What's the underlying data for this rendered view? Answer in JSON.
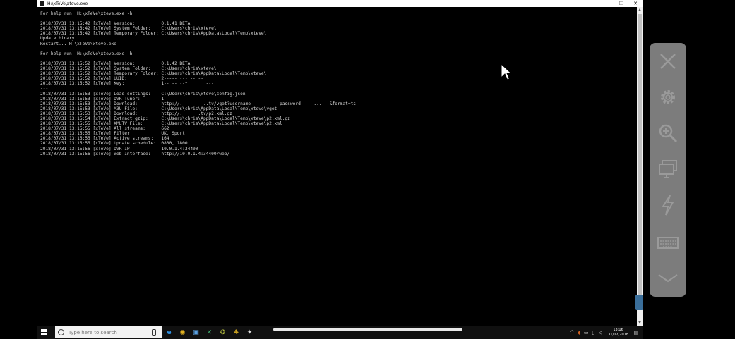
{
  "window": {
    "title": "H:\\xTeVe\\xteve.exe",
    "minimize": "—",
    "maximize": "❐",
    "close": "✕"
  },
  "console": {
    "lines": [
      "For help run: H:\\xTeVe\\xteve.exe -h",
      "",
      "2018/07/31 13:15:42 [xTeVe] Version:          0.1.41 BETA",
      "2018/07/31 13:15:42 [xTeVe] System Folder:    C:\\Users\\chris\\xteve\\",
      "2018/07/31 13:15:42 [xTeVe] Temporary Folder: C:\\Users\\chris\\AppData\\Local\\Temp\\xteve\\",
      "Update binary...",
      "Restart... H:\\xTeVe\\xteve.exe",
      "",
      "For help run: H:\\xTeVe\\xteve.exe -h",
      "",
      "2018/07/31 13:15:52 [xTeVe] Version:          0.1.42 BETA",
      "2018/07/31 13:15:52 [xTeVe] System Folder:    C:\\Users\\chris\\xteve\\",
      "2018/07/31 13:15:52 [xTeVe] Temporary Folder: C:\\Users\\chris\\AppData\\Local\\Temp\\xteve\\",
      "2018/07/31 13:15:52 [xTeVe] UUID:             2----- --- -- --",
      "2018/07/31 13:15:52 [xTeVe] Key:              1-- -- --*       ---",
      "---",
      "2018/07/31 13:15:53 [xTeVe] Load settings:    C:\\Users\\chris\\xteve\\config.json",
      "2018/07/31 13:15:53 [xTeVe] DVR Tuner:        1",
      "2018/07/31 13:15:53 [xTeVe] Download:         http://.        ..tv/vget?username-         -password-    ...   &format=ts",
      "2018/07/31 13:15:53 [xTeVe] M3U File:         C:\\Users\\chris\\AppData\\Local\\Temp\\xteve\\vget",
      "2018/07/31 13:15:53 [xTeVe] Download:         http://.      .tv/p2.xml.gz",
      "2018/07/31 13:15:54 [xTeVe] Extract gzip:     C:\\Users\\chris\\AppData\\Local\\Temp\\xteve\\p2.xml.gz",
      "2018/07/31 13:15:55 [xTeVe] XMLTV File:       C:\\Users\\chris\\AppData\\Local\\Temp\\xteve\\p2.xml",
      "2018/07/31 13:15:55 [xTeVe] All streams:      662",
      "2018/07/31 13:15:55 [xTeVe] Filter:           UK, Sport",
      "2018/07/31 13:15:55 [xTeVe] Active streams:   164",
      "2018/07/31 13:15:55 [xTeVe] Update schedule:  0800, 1800",
      "2018/07/31 13:15:56 [xTeVe] DVR IP:           10.0.1.4:34400",
      "2018/07/31 13:15:56 [xTeVe] Web Interface:    http://10.0.1.4:34400/web/"
    ]
  },
  "remote_panel": {
    "buttons": [
      "close-icon",
      "gear-icon",
      "zoom-icon",
      "monitor-icon",
      "lightning-icon",
      "keyboard-icon",
      "chevron-down-icon"
    ],
    "color": "#7c7c7c"
  },
  "taskbar": {
    "search_placeholder": "Type here to search",
    "clock_time": "13:16",
    "clock_date": "31/07/2018",
    "apps": [
      "edge-icon",
      "chrome-icon",
      "store-icon",
      "excel-icon",
      "app-icon",
      "app-icon",
      "app-icon"
    ]
  }
}
